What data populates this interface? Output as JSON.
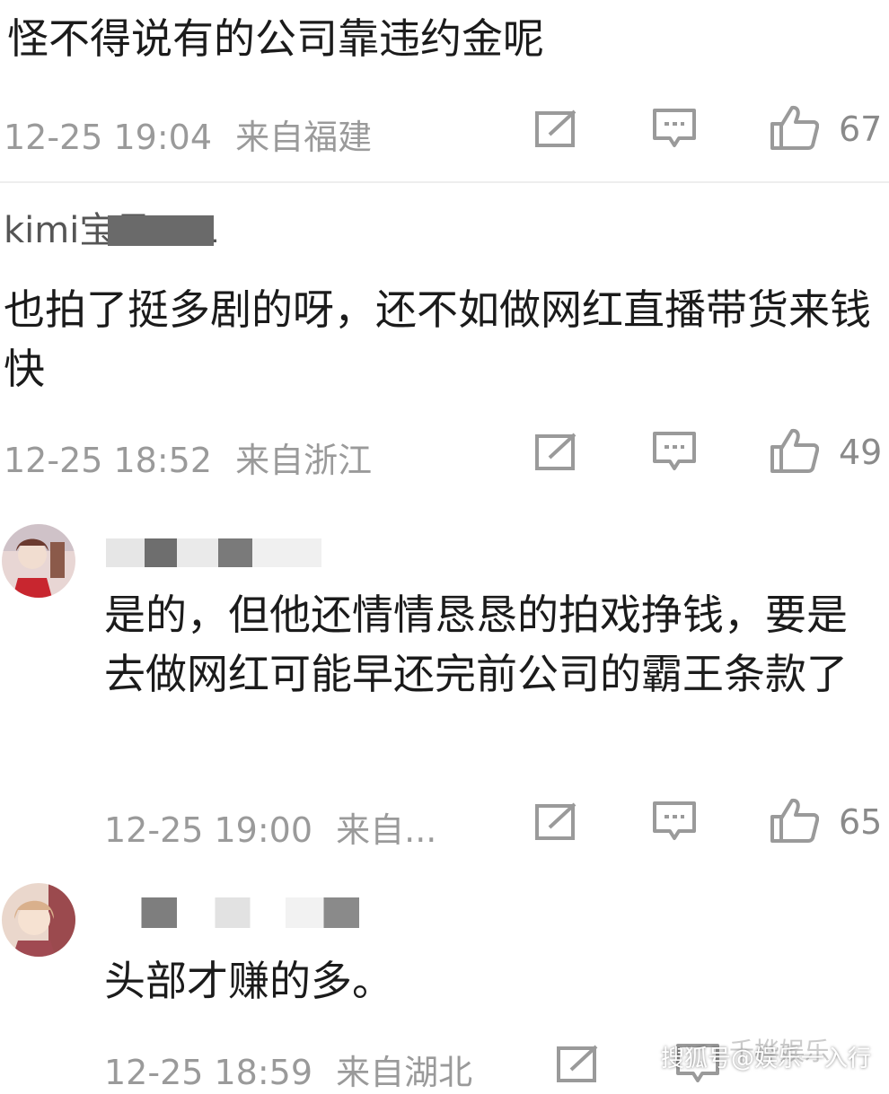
{
  "comments": [
    {
      "text": "怪不得说有的公司靠违约金呢",
      "time": "12-25 19:04",
      "location": "来自福建",
      "likes": "67"
    },
    {
      "username": "kimi宝贝321",
      "text": "也拍了挺多剧的呀，还不如做网红直播带货来钱快",
      "time": "12-25 18:52",
      "location": "来自浙江",
      "likes": "49"
    },
    {
      "text": "是的，但他还情情恳恳的拍戏挣钱，要是去做网红可能早还完前公司的霸王条款了",
      "time": "12-25 19:00",
      "location": "来自...",
      "likes": "65"
    },
    {
      "text": "头部才赚的多。",
      "time": "12-25 18:59",
      "location": "来自湖北"
    }
  ],
  "watermark": {
    "text": "搜狐号@娱乐一入行",
    "logo_text": "千桦娱乐"
  },
  "colors": {
    "text": "#1b1b1b",
    "meta": "#9a9a9a",
    "icon": "#9a9a9a",
    "divider": "#eeeeee"
  }
}
